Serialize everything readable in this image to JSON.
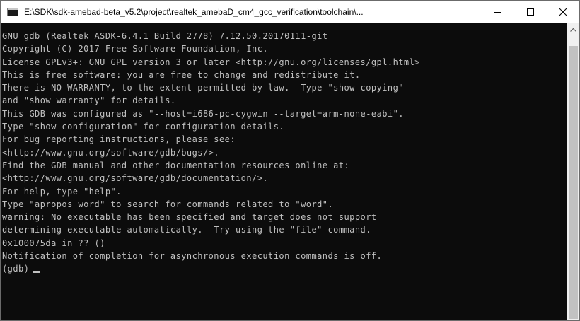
{
  "window": {
    "title": "E:\\SDK\\sdk-amebad-beta_v5.2\\project\\realtek_amebaD_cm4_gcc_verification\\toolchain\\...",
    "minimize_icon": "minimize-icon",
    "maximize_icon": "maximize-icon",
    "close_icon": "close-icon"
  },
  "console": {
    "lines": [
      "GNU gdb (Realtek ASDK-6.4.1 Build 2778) 7.12.50.20170111-git",
      "Copyright (C) 2017 Free Software Foundation, Inc.",
      "License GPLv3+: GNU GPL version 3 or later <http://gnu.org/licenses/gpl.html>",
      "This is free software: you are free to change and redistribute it.",
      "There is NO WARRANTY, to the extent permitted by law.  Type \"show copying\"",
      "and \"show warranty\" for details.",
      "This GDB was configured as \"--host=i686-pc-cygwin --target=arm-none-eabi\".",
      "Type \"show configuration\" for configuration details.",
      "For bug reporting instructions, please see:",
      "<http://www.gnu.org/software/gdb/bugs/>.",
      "Find the GDB manual and other documentation resources online at:",
      "<http://www.gnu.org/software/gdb/documentation/>.",
      "For help, type \"help\".",
      "Type \"apropos word\" to search for commands related to \"word\".",
      "warning: No executable has been specified and target does not support",
      "determining executable automatically.  Try using the \"file\" command.",
      "0x100075da in ?? ()",
      "Notification of completion for asynchronous execution commands is off."
    ],
    "prompt": "(gdb)"
  },
  "colors": {
    "console_bg": "#0c0c0c",
    "console_text": "#c0c0c0",
    "titlebar_bg": "#ffffff"
  }
}
